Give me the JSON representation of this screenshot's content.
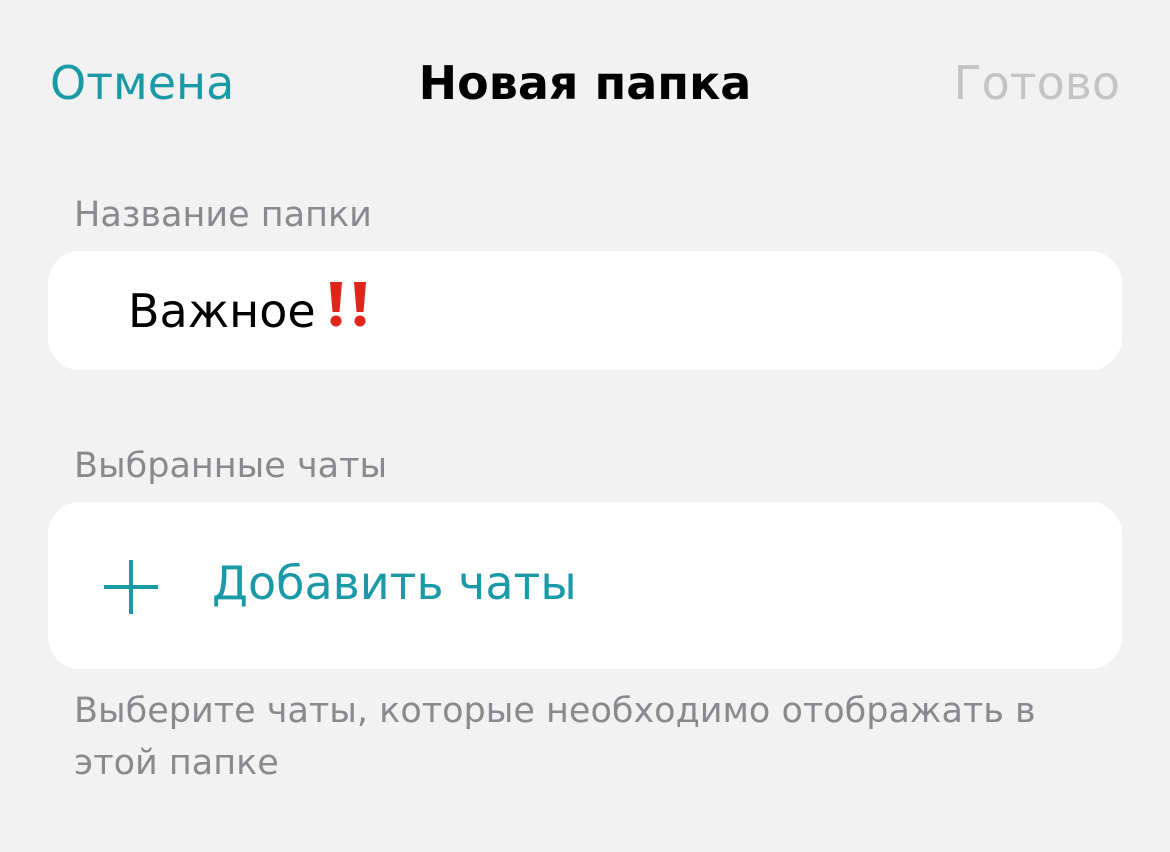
{
  "nav": {
    "cancel_label": "Отмена",
    "title": "Новая папка",
    "done_label": "Готово"
  },
  "folder_name": {
    "label": "Название папки",
    "value": "Важное",
    "emoji": "!!"
  },
  "chats": {
    "label": "Выбранные чаты",
    "add_label": "Добавить чаты",
    "footnote": "Выберите чаты, которые необходимо отображать в этой папке"
  },
  "colors": {
    "accent": "#1a9aa7",
    "disabled": "#c4c4c4",
    "secondary_text": "#8a8a8e",
    "emoji_red": "#e0261b"
  },
  "icons": {
    "add": "plus-icon",
    "emoji": "double-exclamation-icon"
  }
}
